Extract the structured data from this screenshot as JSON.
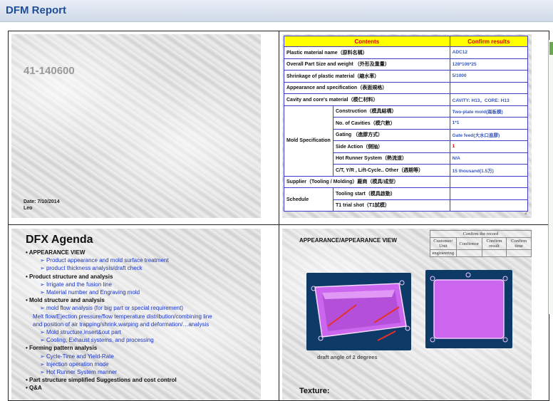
{
  "header": {
    "title": "DFM Report"
  },
  "slide1": {
    "code": "41-140600",
    "date": "Date: 7/10/2014",
    "author": "Leo"
  },
  "slide2": {
    "headers": [
      "Contents",
      "Confirm results"
    ],
    "rows": [
      {
        "label": "Plastic material name（原料名稱）",
        "value": "ADC12"
      },
      {
        "label": "Overall Part Size and weight （外形及重量）",
        "value": "128*106*25"
      },
      {
        "label": "Shrinkage of plastic material（縮水率）",
        "value": "5/1000"
      },
      {
        "label": "Appearance and specification（表面規格）",
        "value": ""
      },
      {
        "label": "Cavity and core's material（模仁材料）",
        "value": "CAVITY: H13，CORE: H13"
      }
    ],
    "mold_label": "Mold Specification",
    "mold_rows": [
      {
        "label": "Construction（模具結構）",
        "value": "Two-plate mold(兩板模)"
      },
      {
        "label": "No. of Cavities（模穴數）",
        "value": "1*1"
      },
      {
        "label": "Gating （進膠方式）",
        "value": "Gate feed(大水口進膠)"
      },
      {
        "label": "Side Action（側抽）",
        "value": "1"
      },
      {
        "label": "Hot Runner System（熱流道）",
        "value": "N/A"
      },
      {
        "label": "C/T, Y/R , Lift-Cycle.. Other（週期等）",
        "value": "15 thousand(1.5万)"
      }
    ],
    "supplier": "Supplier（Tooling / Molding）廠商（模具/成型）",
    "schedule_label": "Schedule",
    "schedule_rows": [
      {
        "label": "Tooling start（模具啟動）",
        "value": ""
      },
      {
        "label": "T1 trial shot（T1試模）",
        "value": ""
      }
    ],
    "page": "2"
  },
  "slide3": {
    "title": "DFX Agenda",
    "items": [
      {
        "t": "APPEARANCE VIEW",
        "k": "h"
      },
      {
        "t": "Product appearance and mold surface treatment",
        "k": "sub"
      },
      {
        "t": "product thickness analysis/draft check",
        "k": "sub"
      },
      {
        "t": "Product structure and analysis",
        "k": "h"
      },
      {
        "t": "Irrigate and the fusion line",
        "k": "sub"
      },
      {
        "t": "Material number and Engraving mold",
        "k": "sub"
      },
      {
        "t": "Mold structure and analysis",
        "k": "h"
      },
      {
        "t": "mold flow analysis (for big part or special requirement)",
        "k": "sub"
      },
      {
        "t": "Melt flow/Ejection pressure/flow temperature distribution/combining line",
        "k": "wrap"
      },
      {
        "t": "and position of air trapping/shrink,warping and deformation/…analysis",
        "k": "wrap"
      },
      {
        "t": "Mold structure,insert&out part",
        "k": "sub"
      },
      {
        "t": "Cooling, Exhaust systems, and processing",
        "k": "sub"
      },
      {
        "t": "Forming pattern analysis",
        "k": "h"
      },
      {
        "t": "Cycle-Time and Yield-Rate",
        "k": "sub"
      },
      {
        "t": "Injection operation mode",
        "k": "sub"
      },
      {
        "t": "Hot Runner System manner",
        "k": "sub"
      },
      {
        "t": "Part structure simplified Suggestions and cost control",
        "k": "h"
      },
      {
        "t": "Q&A",
        "k": "h"
      }
    ]
  },
  "slide4": {
    "title": "APPEARANCE/APPEARANCE VIEW",
    "record_title": "Confirm the record",
    "record_cols": [
      "Customer/ Unit",
      "Confirmor",
      "Confirm result",
      "Confirm time"
    ],
    "record_row": "engineering",
    "caption": "draft angle of 2 degrees",
    "texture": "Texture:",
    "part_color": "#cc66ee",
    "arrow_color": "#e8302a"
  }
}
